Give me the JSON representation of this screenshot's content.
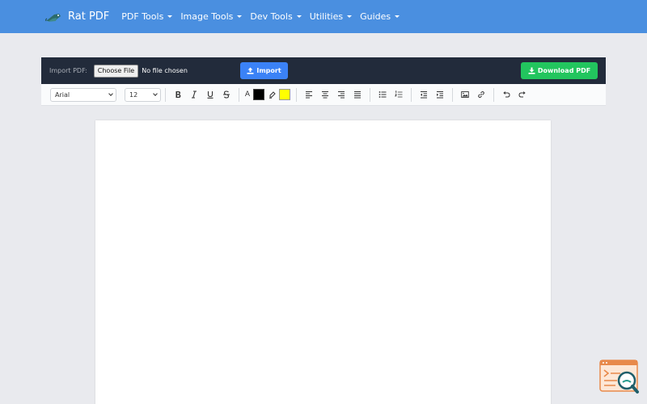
{
  "brand": {
    "name": "Rat PDF",
    "logo": "rat-icon"
  },
  "nav": {
    "items": [
      {
        "label": "PDF Tools"
      },
      {
        "label": "Image Tools"
      },
      {
        "label": "Dev Tools"
      },
      {
        "label": "Utilities"
      },
      {
        "label": "Guides"
      }
    ]
  },
  "importbar": {
    "label": "Import PDF:",
    "file_button": "Choose File",
    "file_status": "No file chosen",
    "import_button": "Import",
    "download_button": "Download PDF"
  },
  "toolbar": {
    "font_family": "Arial",
    "font_size": "12",
    "text_color": "#000000",
    "highlight_color": "#ffff00",
    "text_color_glyph": "A"
  },
  "colors": {
    "navbar": "#4a8fe0",
    "importbar": "#222b3b",
    "import_button": "#3b82f6",
    "download_button": "#22c55e"
  }
}
